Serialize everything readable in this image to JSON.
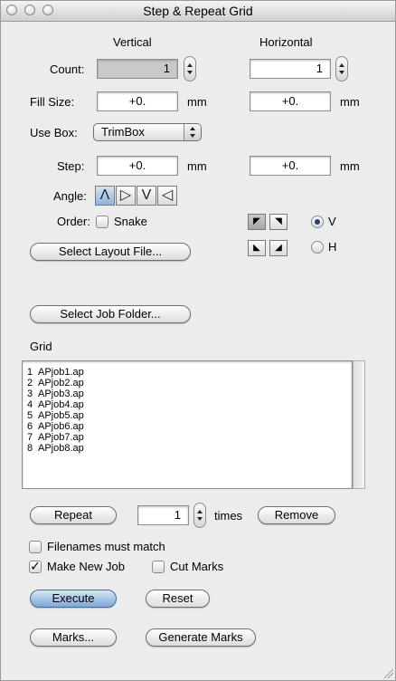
{
  "window": {
    "title": "Step & Repeat Grid"
  },
  "headers": {
    "vertical": "Vertical",
    "horizontal": "Horizontal"
  },
  "count": {
    "label": "Count:",
    "vertical": "1",
    "horizontal": "1"
  },
  "fill_size": {
    "label": "Fill Size:",
    "vertical": "+0.",
    "horizontal": "+0.",
    "unit": "mm"
  },
  "use_box": {
    "label": "Use Box:",
    "value": "TrimBox"
  },
  "step": {
    "label": "Step:",
    "vertical": "+0.",
    "horizontal": "+0.",
    "unit": "mm"
  },
  "angle": {
    "label": "Angle:",
    "options": [
      "Λ",
      "▷",
      "V",
      "◁"
    ],
    "selected": 0
  },
  "order": {
    "label": "Order:",
    "snake_label": "Snake",
    "radio_v": "V",
    "radio_h": "H",
    "selected_radio": "V"
  },
  "buttons": {
    "select_layout": "Select Layout File...",
    "select_job": "Select Job Folder...",
    "repeat": "Repeat",
    "remove": "Remove",
    "execute": "Execute",
    "reset": "Reset",
    "marks": "Marks...",
    "generate_marks": "Generate Marks"
  },
  "grid": {
    "label": "Grid",
    "items": [
      {
        "n": "1",
        "name": "APjob1.ap"
      },
      {
        "n": "2",
        "name": "APjob2.ap"
      },
      {
        "n": "3",
        "name": "APjob3.ap"
      },
      {
        "n": "4",
        "name": "APjob4.ap"
      },
      {
        "n": "5",
        "name": "APjob5.ap"
      },
      {
        "n": "6",
        "name": "APjob6.ap"
      },
      {
        "n": "7",
        "name": "APjob7.ap"
      },
      {
        "n": "8",
        "name": "APjob8.ap"
      }
    ]
  },
  "repeat": {
    "times_value": "1",
    "times_label": "times"
  },
  "options": {
    "filenames_must_match": {
      "label": "Filenames must match",
      "checked": false
    },
    "make_new_job": {
      "label": "Make New Job",
      "checked": true
    },
    "cut_marks": {
      "label": "Cut Marks",
      "checked": false
    }
  }
}
